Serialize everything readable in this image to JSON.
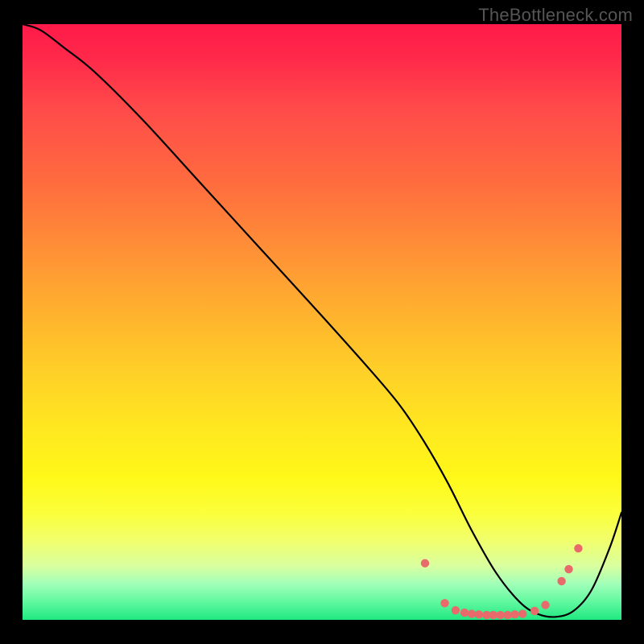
{
  "attribution": "TheBottleneck.com",
  "chart_data": {
    "type": "line",
    "title": "",
    "xlabel": "",
    "ylabel": "",
    "xlim": [
      0,
      100
    ],
    "ylim": [
      0,
      100
    ],
    "series": [
      {
        "name": "bottleneck-curve",
        "x": [
          0,
          3,
          7,
          12,
          20,
          30,
          40,
          50,
          58,
          63,
          67,
          71,
          75,
          79,
          83,
          86,
          89,
          92,
          95,
          98,
          100
        ],
        "values": [
          100,
          99,
          96,
          92,
          84,
          73,
          62,
          51,
          42,
          36,
          30,
          23,
          15,
          8,
          3,
          1,
          0.5,
          1.5,
          5,
          12,
          18
        ]
      }
    ],
    "annotations": {
      "marker_cluster_x_range": [
        67,
        93
      ],
      "marker_cluster_y_approx": 1
    },
    "markers": [
      {
        "x": 67.2,
        "y": 9.5
      },
      {
        "x": 70.5,
        "y": 2.8
      },
      {
        "x": 72.3,
        "y": 1.6
      },
      {
        "x": 73.8,
        "y": 1.2
      },
      {
        "x": 75.0,
        "y": 1.0
      },
      {
        "x": 76.2,
        "y": 0.9
      },
      {
        "x": 77.5,
        "y": 0.8
      },
      {
        "x": 78.6,
        "y": 0.8
      },
      {
        "x": 79.8,
        "y": 0.8
      },
      {
        "x": 81.0,
        "y": 0.8
      },
      {
        "x": 82.2,
        "y": 0.9
      },
      {
        "x": 83.5,
        "y": 1.0
      },
      {
        "x": 85.5,
        "y": 1.5
      },
      {
        "x": 87.3,
        "y": 2.5
      },
      {
        "x": 90.0,
        "y": 6.5
      },
      {
        "x": 91.2,
        "y": 8.5
      },
      {
        "x": 92.8,
        "y": 12.0
      }
    ],
    "colors": {
      "curve": "#000000",
      "marker": "#e86a6a"
    }
  }
}
